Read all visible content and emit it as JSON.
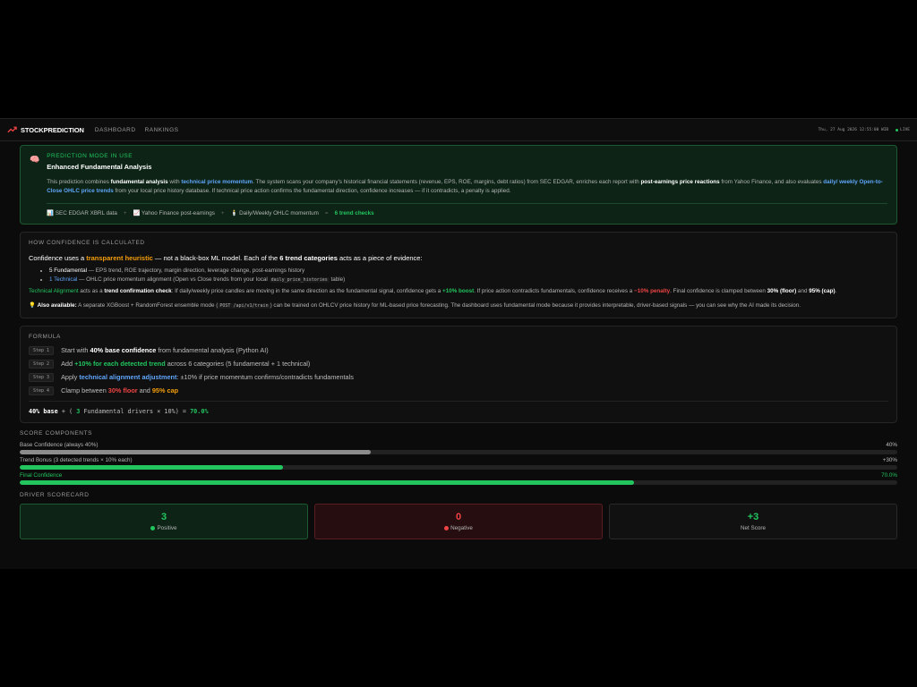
{
  "app": {
    "brand": "STOCKPREDICTION",
    "nav": [
      "DASHBOARD",
      "RANKINGS"
    ],
    "datetime": "Thu, 27 Aug 2026 12:55:00 WIB",
    "live": "LIVE"
  },
  "mode": {
    "label": "PREDICTION MODE IN USE",
    "title": "Enhanced Fundamental Analysis",
    "d1": "This prediction combines ",
    "k1": "fundamental analysis",
    "d2": " with ",
    "k2": "technical price momentum",
    "d3": ". The system scans your company's historical financial statements (revenue, EPS, ROE, margins, debt ratios) from SEC EDGAR, enriches each report with ",
    "k3": "post-earnings price reactions",
    "d4": " from Yahoo Finance, and also evaluates ",
    "k4": "daily/ weekly Open-to-Close OHLC price trends",
    "d5": " from your local price history database. If technical price action confirms the fundamental direction, confidence increases — if it contradicts, a penalty is applied.",
    "sources": [
      "SEC EDGAR XBRL data",
      "Yahoo Finance post-earnings",
      "Daily/Weekly OHLC momentum"
    ],
    "sep": "+",
    "eq": "=",
    "result": "6 trend checks"
  },
  "confidence": {
    "title": "HOW CONFIDENCE IS CALCULATED",
    "l1": "Confidence uses a ",
    "l2": "transparent heuristic",
    "l3": " — not a black-box ML model. Each of the ",
    "l4": "6 trend categories",
    "l5": " acts as a piece of evidence:",
    "b1a": "5 Fundamental",
    "b1b": " — EPS trend, ROE trajectory, margin direction, leverage change, post-earnings history",
    "b2a": "1 Technical",
    "b2b": " — OHLC price momentum alignment (Open vs Close trends from your local ",
    "b2code": "daily_price_histories",
    "b2c": " table)",
    "p1": "Technical Alignment",
    "p2": " acts as a ",
    "p3": "trend confirmation check",
    "p4": ": If daily/weekly price candles are moving in the same direction as the fundamental signal, confidence gets a ",
    "p5": "+10% boost",
    "p6": ". If price action contradicts fundamentals, confidence receives a ",
    "p7": "−10% penalty",
    "p8": ". Final confidence is clamped between ",
    "p9": "30% (floor)",
    "p10": " and ",
    "p11": "95% (cap)",
    "p12": ".",
    "a1": "Also available:",
    "a2": " A separate XGBoost + RandomForest ensemble mode (",
    "acode": "POST /api/v1/train",
    "a3": ") can be trained on OHLCV price history for ML-based price forecasting. The dashboard uses fundamental mode because it provides interpretable, driver-based signals — you can see why the AI made its decision."
  },
  "formula": {
    "title": "FORMULA",
    "steps": [
      {
        "badge": "Step 1",
        "a": "Start with ",
        "b": "40% base confidence",
        "c": " from fundamental analysis (Python AI)"
      },
      {
        "badge": "Step 2",
        "a": "Add ",
        "b": "+10% for each detected trend",
        "c": " across 6 categories (5 fundamental + 1 technical)"
      },
      {
        "badge": "Step 3",
        "a": "Apply ",
        "b": "technical alignment adjustment",
        "c": ": ±10% if price momentum confirms/contradicts fundamentals"
      },
      {
        "badge": "Step 4",
        "a": "Clamp between ",
        "b": "30% floor",
        "c": " and ",
        "d": "95% cap"
      }
    ],
    "eq1": "40% base",
    "eq2": " + ( ",
    "eq3": "3",
    "eq4": " Fundamental drivers × 10%) = ",
    "eq5": "70.0%"
  },
  "components": {
    "title": "SCORE COMPONENTS",
    "items": [
      {
        "label": "Base Confidence (always 40%)",
        "value": "40%",
        "fill": 0.4,
        "color": "#8c8c8c"
      },
      {
        "label": "Trend Bonus (3 detected trends × 10% each)",
        "value": "+30%",
        "fill": 0.3,
        "color": "#22c55e"
      },
      {
        "label": "Final Confidence",
        "value": "70.0%",
        "fill": 0.7,
        "color": "#22c55e"
      }
    ]
  },
  "scorecard": {
    "title": "DRIVER SCORECARD",
    "positive": {
      "value": "3",
      "label": "Positive",
      "color": "#22c55e"
    },
    "negative": {
      "value": "0",
      "label": "Negative",
      "color": "#ef4444"
    },
    "net": {
      "value": "+3",
      "label": "Net Score",
      "color": "#22c55e"
    }
  }
}
